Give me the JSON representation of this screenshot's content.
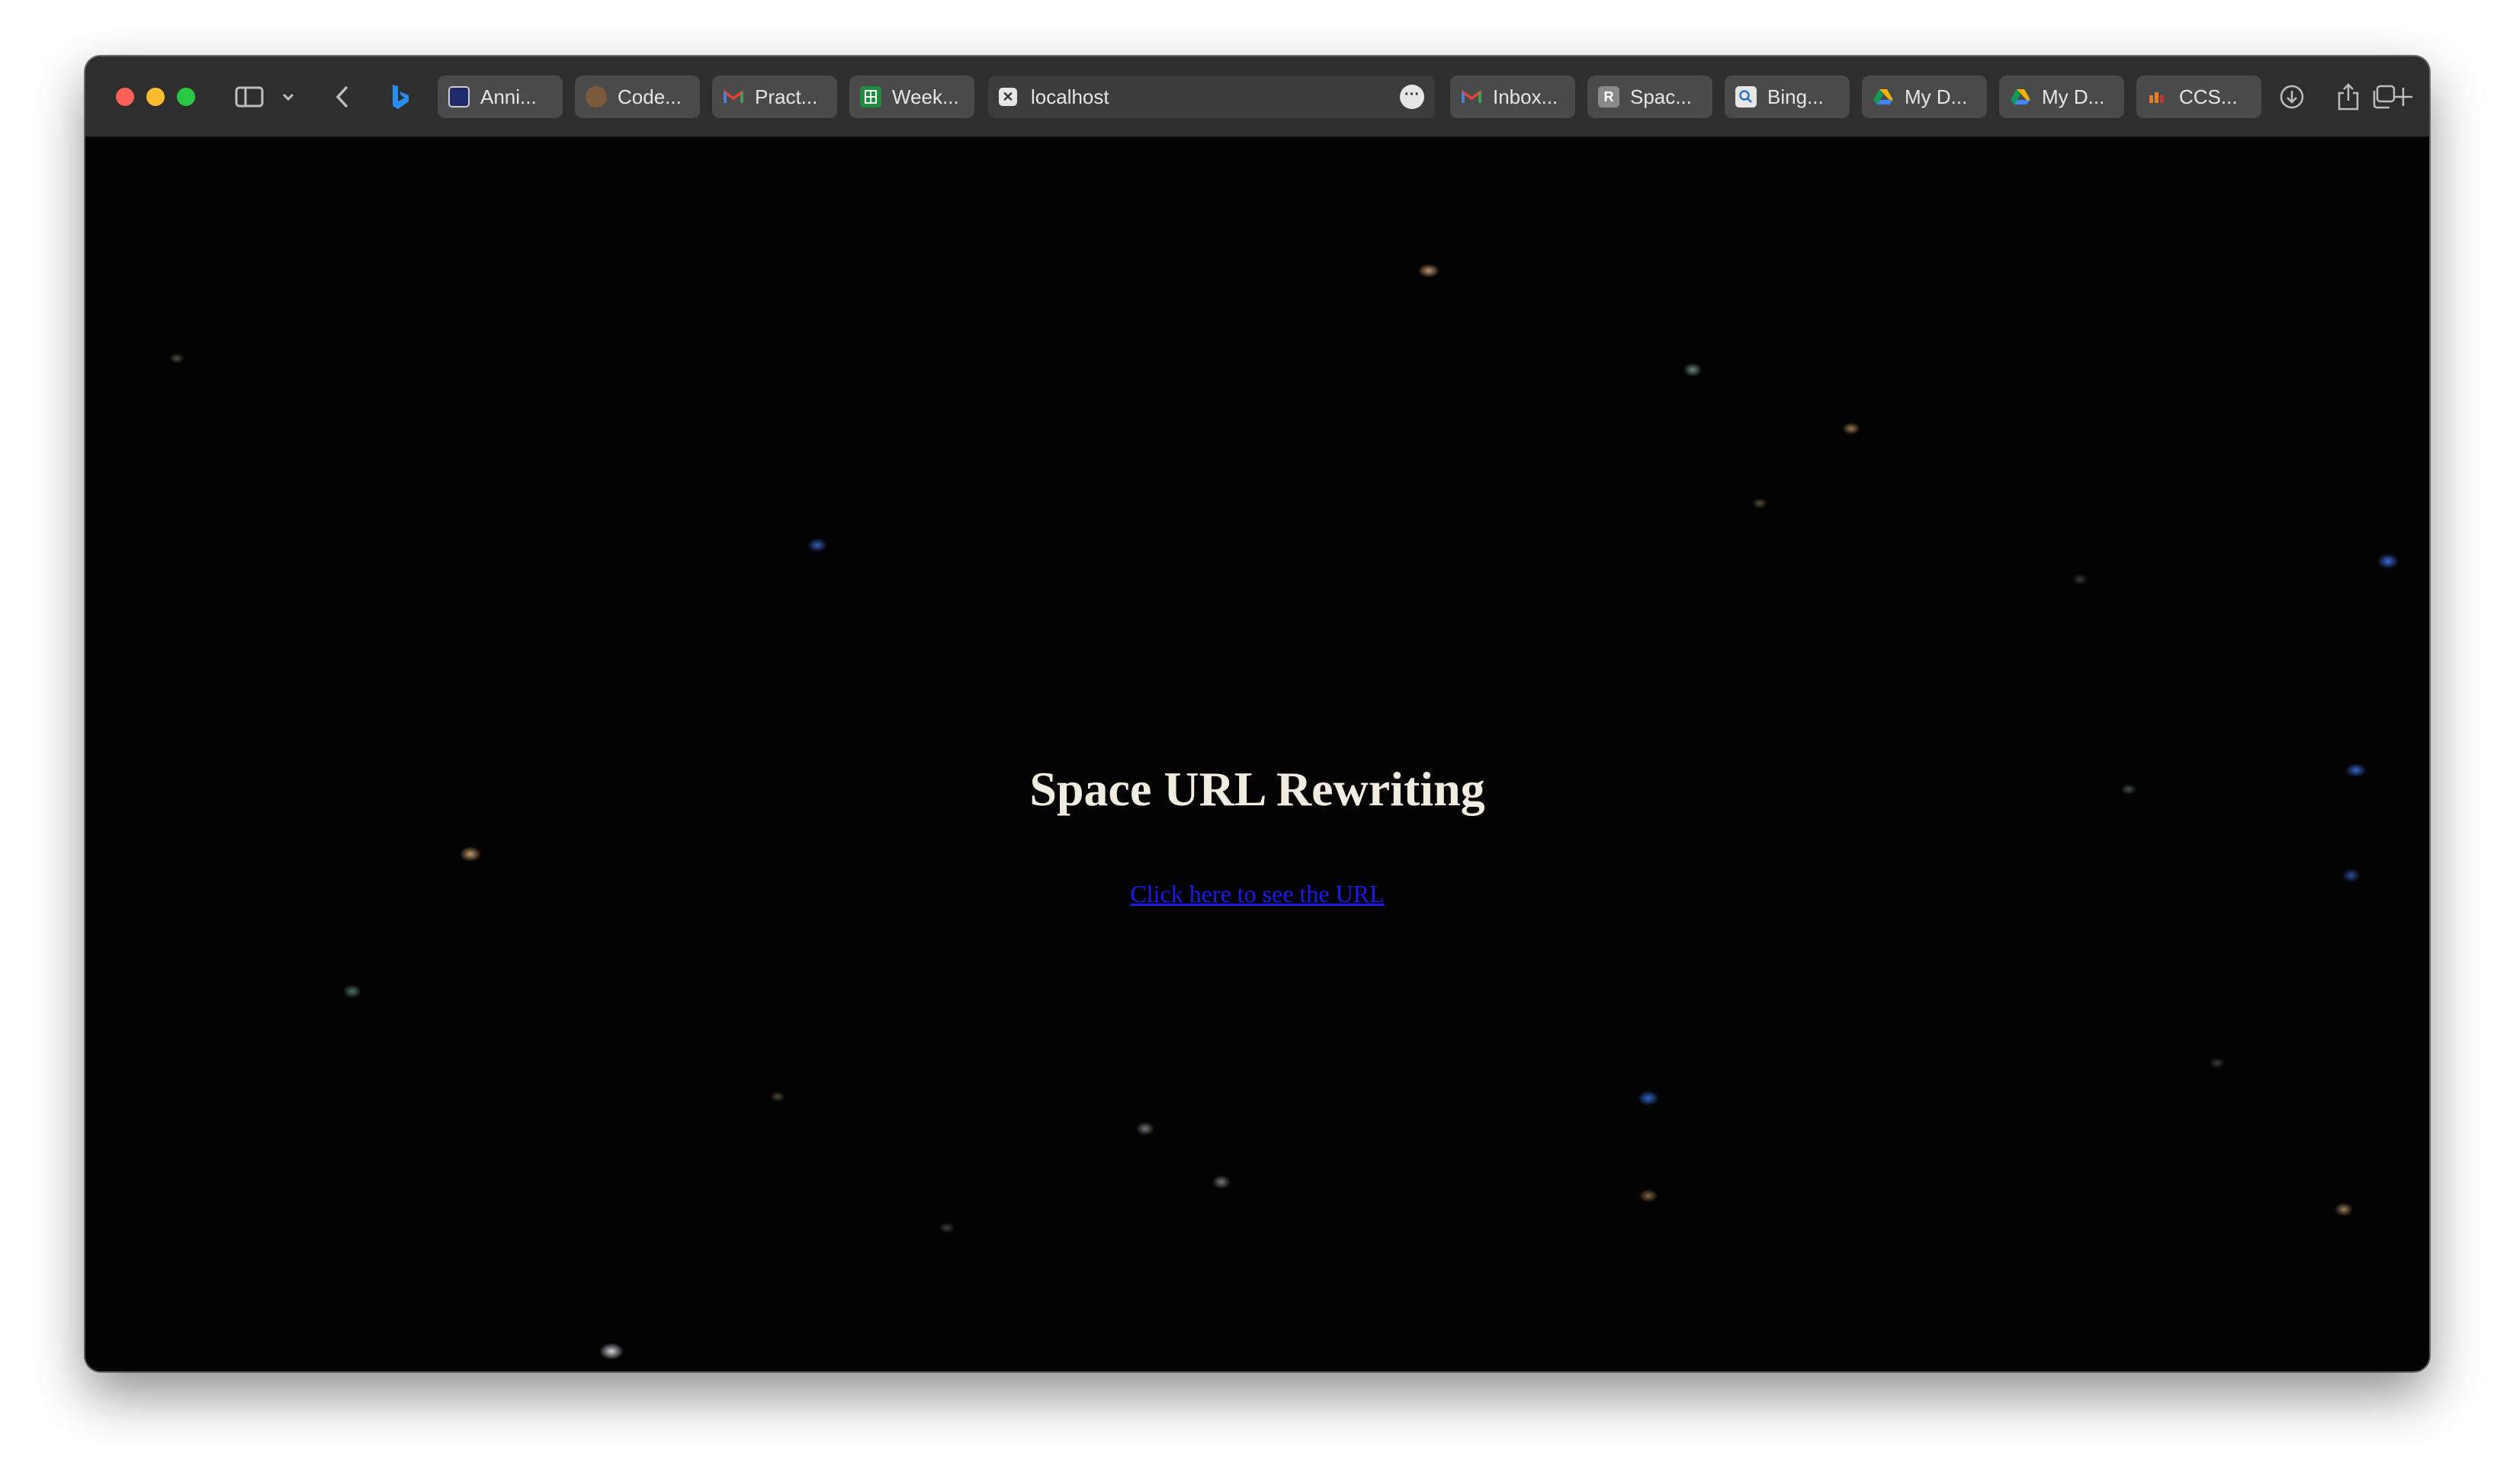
{
  "browser": {
    "tabs": [
      {
        "label": "Anni...",
        "icon": "document-icon",
        "color": "#1f2a6b"
      },
      {
        "label": "Code...",
        "icon": "avatar-icon",
        "color": "#7a5a3a"
      },
      {
        "label": "Pract...",
        "icon": "gmail-icon",
        "color": "#d44638"
      },
      {
        "label": "Week...",
        "icon": "sheets-icon",
        "color": "#1e8e3e"
      },
      {
        "label": "localhost",
        "icon": "close-icon",
        "color": "#e6e6e6"
      },
      {
        "label": "Inbox...",
        "icon": "gmail-icon",
        "color": "#d44638"
      },
      {
        "label": "Spac...",
        "icon": "replit-icon",
        "color": "#8a8a8a"
      },
      {
        "label": "Bing...",
        "icon": "search-icon",
        "color": "#e6e6e6"
      },
      {
        "label": "My D...",
        "icon": "drive-icon",
        "color": "#f4b400"
      },
      {
        "label": "My D...",
        "icon": "drive-icon",
        "color": "#f4b400"
      },
      {
        "label": "CCS...",
        "icon": "ccs-icon",
        "color": "#e67e22"
      }
    ],
    "favicon_letters": {
      "spaces": "R"
    }
  },
  "page": {
    "heading": "Space URL Rewriting",
    "link_text": "Click here to see the URL"
  }
}
